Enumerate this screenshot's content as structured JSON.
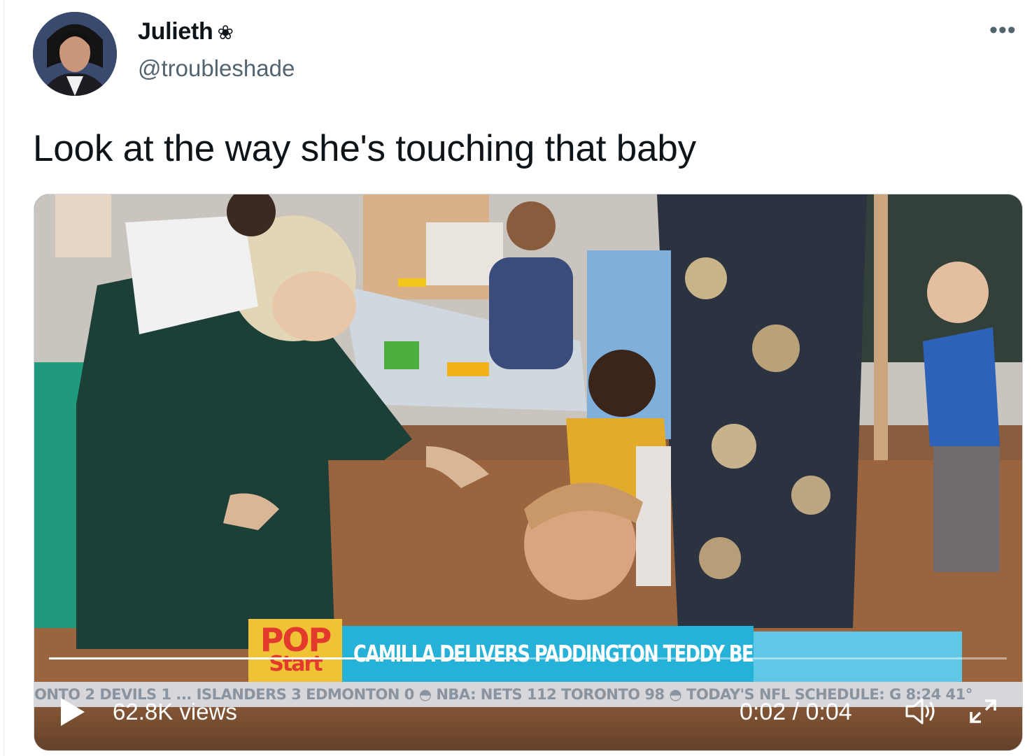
{
  "author": {
    "name": "Julieth",
    "name_emoji": "❀",
    "handle": "@troubleshade",
    "avatar_icon": "avatar-photo"
  },
  "more_label": "•••",
  "tweet": {
    "text": "Look at the way she's touching that baby"
  },
  "video": {
    "chyron_brand_top": "POP",
    "chyron_brand_bottom": "Start",
    "headline": "CAMILLA DELIVERS PADDINGTON TEDDY BEARS",
    "ticker": "ONTO 2 DEVILS 1 ... ISLANDERS 3 EDMONTON 0   ◓  NBA: NETS 112 TORONTO 98   ◓  TODAY'S NFL SCHEDULE: G   8:24  41°",
    "views": "62.8K views",
    "time": "0:02 / 0:04",
    "progress": 0.5,
    "play_icon": "play-icon",
    "volume_icon": "volume-icon",
    "fullscreen_icon": "fullscreen-icon"
  }
}
